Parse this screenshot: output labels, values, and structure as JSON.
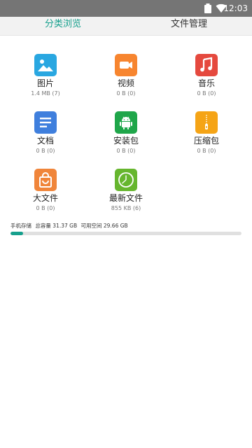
{
  "status_bar": {
    "time": "12:03",
    "icons": [
      "wifi-icon",
      "battery-icon"
    ]
  },
  "tabs": [
    {
      "label": "分类浏览",
      "active": true
    },
    {
      "label": "文件管理",
      "active": false
    }
  ],
  "categories": [
    {
      "label": "图片",
      "size": "1.4 MB (7)",
      "icon": "image-icon",
      "color": "#29a7e1"
    },
    {
      "label": "视频",
      "size": "0 B (0)",
      "icon": "video-icon",
      "color": "#f7852f"
    },
    {
      "label": "音乐",
      "size": "0 B (0)",
      "icon": "music-icon",
      "color": "#e5493e"
    },
    {
      "label": "文档",
      "size": "0 B (0)",
      "icon": "document-icon",
      "color": "#3f7fdd"
    },
    {
      "label": "安装包",
      "size": "0 B (0)",
      "icon": "android-icon",
      "color": "#1fa64a"
    },
    {
      "label": "压缩包",
      "size": "0 B (0)",
      "icon": "zip-icon",
      "color": "#f5a416"
    },
    {
      "label": "大文件",
      "size": "0 B (0)",
      "icon": "bag-icon",
      "color": "#f0853a"
    },
    {
      "label": "最新文件",
      "size": "855 KB (6)",
      "icon": "clock-icon",
      "color": "#66b62e"
    }
  ],
  "storage": {
    "label": "手机存储",
    "total": "总容量 31.37 GB",
    "available": "可用空间 29.66 GB",
    "used_fraction": 0.055,
    "bar_color": "#16a08d",
    "track_color": "#e0e0e0"
  }
}
